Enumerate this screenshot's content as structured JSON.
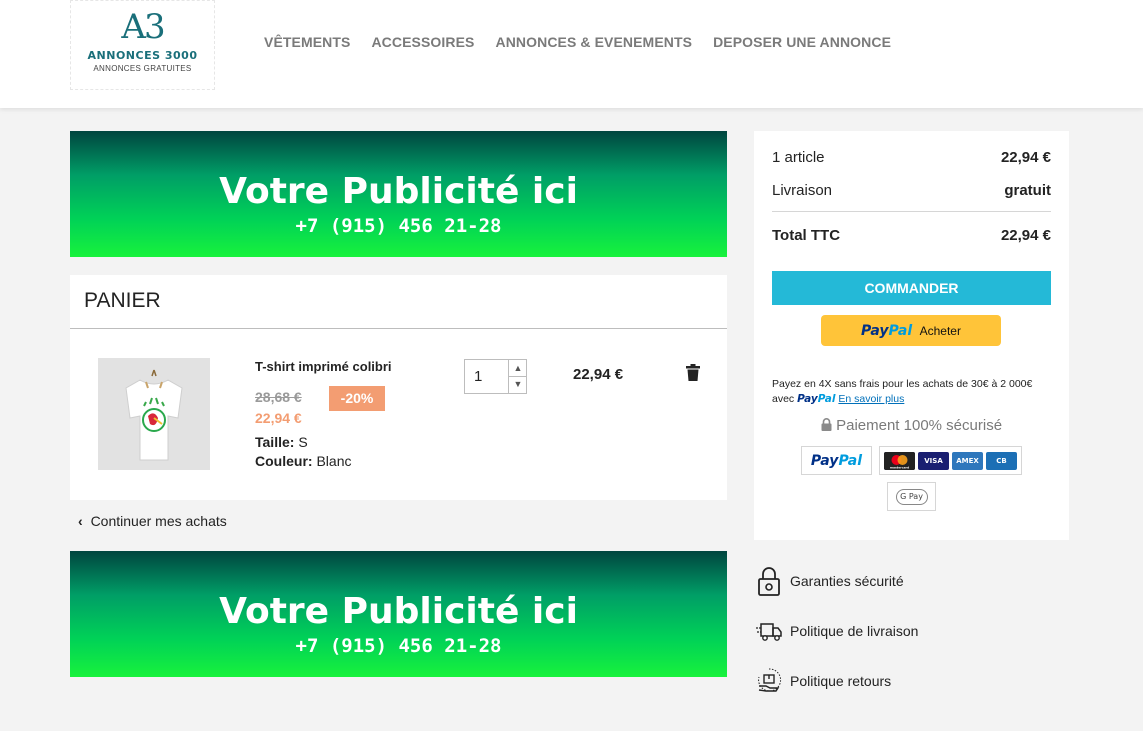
{
  "header": {
    "logo": {
      "mark": "A3",
      "name": "ANNONCES 3000",
      "subtitle": "ANNONCES GRATUITES"
    },
    "nav": [
      {
        "label": "VÊTEMENTS"
      },
      {
        "label": "ACCESSOIRES"
      },
      {
        "label": "ANNONCES & EVENEMENTS"
      },
      {
        "label": "DEPOSER UNE ANNONCE"
      }
    ]
  },
  "ads": {
    "top": {
      "title": "Votre Publicité ici",
      "phone": "+7 (915) 456 21-28"
    },
    "bottom": {
      "title": "Votre Publicité ici",
      "phone": "+7 (915) 456 21-28"
    }
  },
  "cart": {
    "title": "PANIER",
    "item": {
      "name": "T-shirt imprimé colibri",
      "old_price": "28,68 €",
      "discount": "-20%",
      "price": "22,94 €",
      "size_label": "Taille:",
      "size_value": "S",
      "color_label": "Couleur:",
      "color_value": "Blanc",
      "quantity": "1",
      "line_total": "22,94 €"
    },
    "continue_label": "Continuer mes achats"
  },
  "summary": {
    "items_label": "1 article",
    "items_value": "22,94 €",
    "shipping_label": "Livraison",
    "shipping_value": "gratuit",
    "total_label": "Total TTC",
    "total_value": "22,94 €",
    "checkout_label": "COMMANDER",
    "paypal_button": {
      "logo_a": "Pay",
      "logo_b": "Pal",
      "label": "Acheter"
    },
    "pay4x_text": "Payez en 4X sans frais pour les achats de 30€ à 2 000€ avec",
    "pay4x_logo_a": "Pay",
    "pay4x_logo_b": "Pal",
    "pay4x_link": "En savoir plus",
    "secure_label": "Paiement 100% sécurisé",
    "payment_methods": {
      "paypal_a": "Pay",
      "paypal_b": "Pal",
      "mastercard": "mastercard",
      "visa": "VISA",
      "amex": "AMEX",
      "cb": "CB",
      "gpay": "G Pay"
    },
    "colors": {
      "checkout": "#24b9d7",
      "paypal_button": "#ffc439",
      "discount": "#f39d72"
    }
  },
  "reassurance": [
    {
      "icon": "padlock-icon",
      "label": "Garanties sécurité"
    },
    {
      "icon": "delivery-truck-icon",
      "label": "Politique de livraison"
    },
    {
      "icon": "return-package-icon",
      "label": "Politique retours"
    }
  ]
}
